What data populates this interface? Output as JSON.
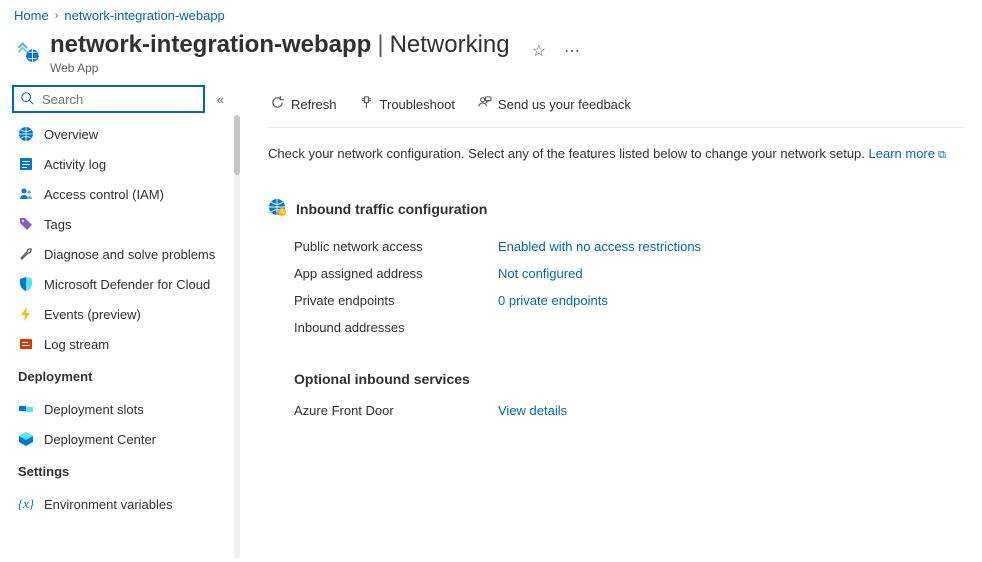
{
  "breadcrumb": {
    "home": "Home",
    "current": "network-integration-webapp"
  },
  "header": {
    "title": "network-integration-webapp",
    "section": "Networking",
    "subtitle": "Web App"
  },
  "sidebar": {
    "search_placeholder": "Search",
    "items": {
      "overview": "Overview",
      "activity": "Activity log",
      "access": "Access control (IAM)",
      "tags": "Tags",
      "diagnose": "Diagnose and solve problems",
      "defender": "Microsoft Defender for Cloud",
      "events": "Events (preview)",
      "logstream": "Log stream"
    },
    "groups": {
      "deployment": "Deployment",
      "settings": "Settings"
    },
    "deployment": {
      "slots": "Deployment slots",
      "center": "Deployment Center"
    },
    "settings": {
      "env": "Environment variables"
    }
  },
  "toolbar": {
    "refresh": "Refresh",
    "troubleshoot": "Troubleshoot",
    "feedback": "Send us your feedback"
  },
  "intro": {
    "text": "Check your network configuration. Select any of the features listed below to change your network setup.",
    "learn_more": "Learn more"
  },
  "inbound": {
    "title": "Inbound traffic configuration",
    "public_access_label": "Public network access",
    "public_access_value": "Enabled with no access restrictions",
    "assigned_label": "App assigned address",
    "assigned_value": "Not configured",
    "private_label": "Private endpoints",
    "private_value": "0 private endpoints",
    "inbound_addr_label": "Inbound addresses"
  },
  "optional": {
    "title": "Optional inbound services",
    "afd_label": "Azure Front Door",
    "afd_value": "View details"
  }
}
